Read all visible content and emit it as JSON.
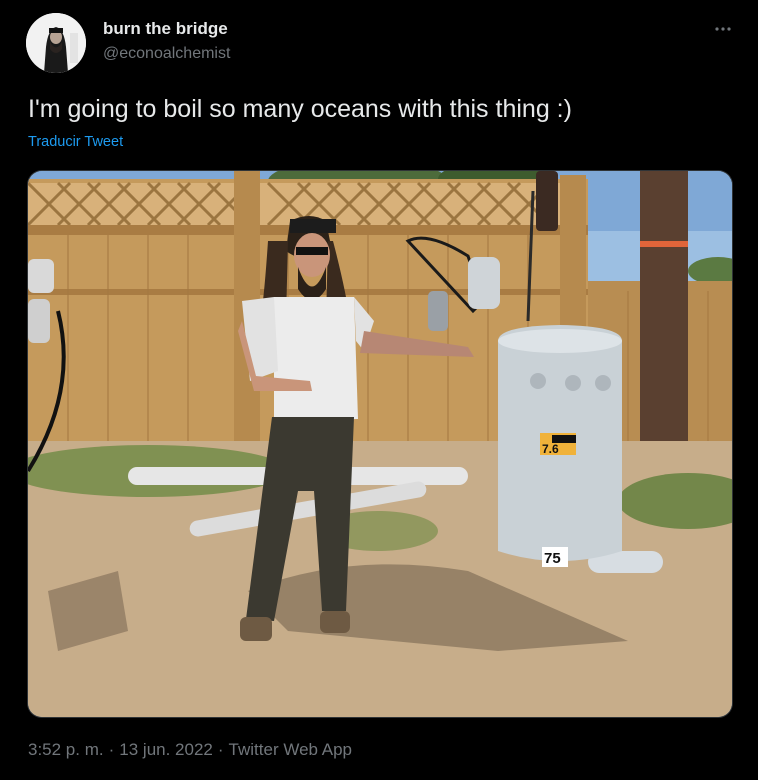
{
  "author": {
    "display_name": "burn the bridge",
    "handle": "@econoalchemist",
    "avatar_icon": "user-avatar"
  },
  "tweet": {
    "text": "I'm going to boil so many oceans with this thing :)",
    "translate_label": "Traducir Tweet",
    "more_icon": "more-options-icon"
  },
  "media": {
    "transformer_label_left": "7.6",
    "transformer_number": "75"
  },
  "meta": {
    "time": "3:52 p. m.",
    "separator": "·",
    "date": "13 jun. 2022",
    "source": "Twitter Web App"
  },
  "colors": {
    "background": "#000000",
    "text_primary": "#e7e9ea",
    "text_secondary": "#71767b",
    "link": "#1d9bf0"
  }
}
